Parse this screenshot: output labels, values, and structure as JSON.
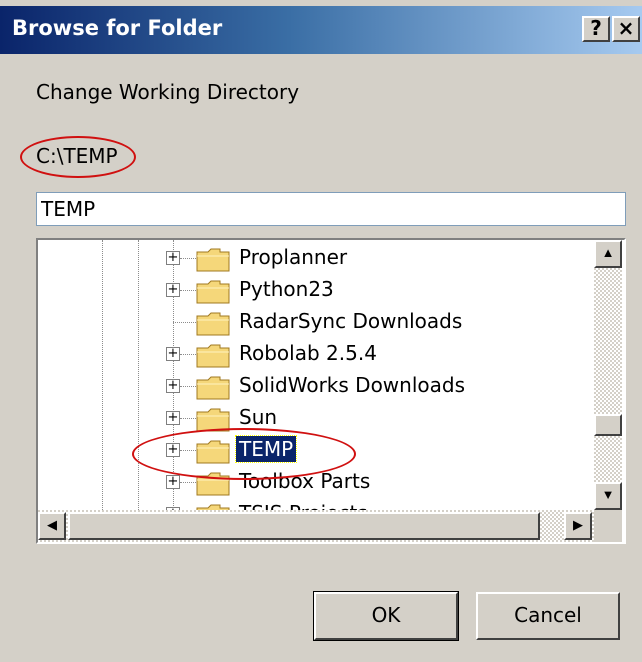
{
  "window": {
    "title": "Browse for Folder",
    "help_label": "?",
    "close_label": "×"
  },
  "description": "Change Working Directory",
  "current_path": "C:\\TEMP",
  "folder_field": {
    "value": "TEMP"
  },
  "tree": {
    "items": [
      {
        "label": "Proplanner",
        "has_children": true,
        "selected": false
      },
      {
        "label": "Python23",
        "has_children": true,
        "selected": false
      },
      {
        "label": "RadarSync Downloads",
        "has_children": false,
        "selected": false
      },
      {
        "label": "Robolab 2.5.4",
        "has_children": true,
        "selected": false
      },
      {
        "label": "SolidWorks Downloads",
        "has_children": true,
        "selected": false
      },
      {
        "label": "Sun",
        "has_children": true,
        "selected": false
      },
      {
        "label": "TEMP",
        "has_children": true,
        "selected": true
      },
      {
        "label": "Toolbox Parts",
        "has_children": true,
        "selected": false
      },
      {
        "label": "TSIS Projects",
        "has_children": true,
        "selected": false
      }
    ]
  },
  "buttons": {
    "ok": "OK",
    "cancel": "Cancel"
  },
  "colors": {
    "titlebar_start": "#0a246a",
    "titlebar_end": "#a6caf0",
    "selection": "#0a246a",
    "annotation": "#d01010",
    "folder": "#f5d77a"
  }
}
